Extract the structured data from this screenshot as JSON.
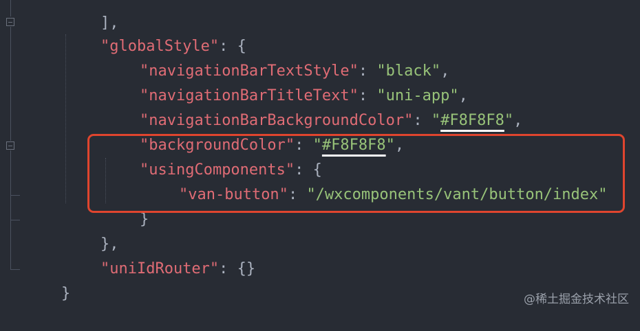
{
  "code": {
    "line_top": "],",
    "global_style_key": "\"globalStyle\"",
    "global_style_open": ": {",
    "nav_text_style_key": "\"navigationBarTextStyle\"",
    "nav_text_style_value": "\"black\"",
    "nav_title_key": "\"navigationBarTitleText\"",
    "nav_title_value": "\"uni-app\"",
    "nav_bg_key": "\"navigationBarBackgroundColor\"",
    "nav_bg_value_q1": "\"",
    "nav_bg_value": "#F8F8F8",
    "nav_bg_value_q2": "\"",
    "bg_key": "\"backgroundColor\"",
    "bg_value_q1": "\"",
    "bg_value": "#F8F8F8",
    "bg_value_q2": "\"",
    "using_components_key": "\"usingComponents\"",
    "using_components_open": ": {",
    "van_button_key": "\"van-button\"",
    "van_button_value": "\"/wxcomponents/vant/button/index\"",
    "inner_close": "}",
    "global_style_close": "},",
    "uni_id_router_key": "\"uniIdRouter\"",
    "uni_id_router_value": ": {}",
    "root_close": "}",
    "colon": ": ",
    "comma": ","
  },
  "watermark": "@稀土掘金技术社区",
  "colors": {
    "background": "#282c34",
    "key": "#e06c75",
    "string": "#98c379",
    "punctuation": "#abb2bf",
    "highlight_box": "#e0452e"
  }
}
